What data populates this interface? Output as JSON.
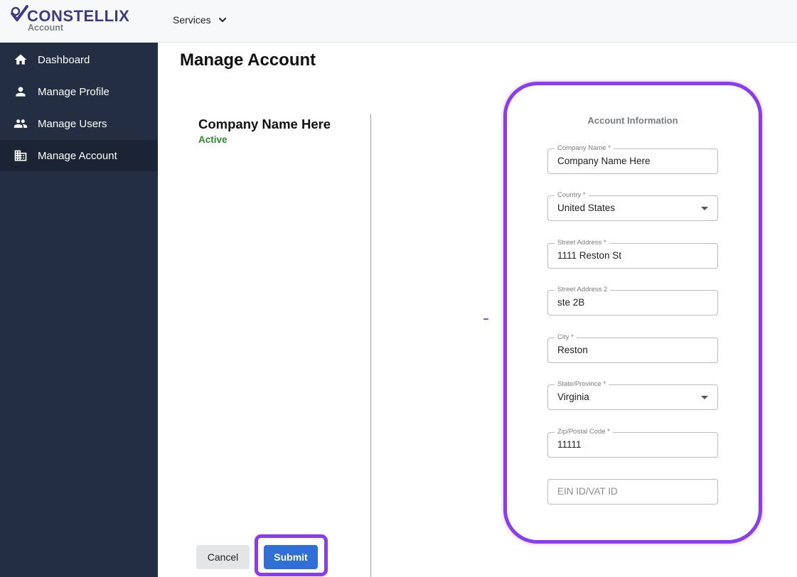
{
  "header": {
    "logo_text": "CONSTELLIX",
    "logo_subtitle": "Account",
    "services_label": "Services"
  },
  "sidebar": {
    "items": [
      {
        "label": "Dashboard",
        "icon": "home-icon",
        "active": false
      },
      {
        "label": "Manage Profile",
        "icon": "person-icon",
        "active": false
      },
      {
        "label": "Manage Users",
        "icon": "people-icon",
        "active": false
      },
      {
        "label": "Manage Account",
        "icon": "building-icon",
        "active": true
      }
    ]
  },
  "main": {
    "page_title": "Manage Account",
    "company": {
      "name": "Company Name Here",
      "status": "Active"
    },
    "account_info": {
      "title": "Account Information",
      "fields": [
        {
          "label": "Company Name *",
          "value": "Company Name Here",
          "type": "text"
        },
        {
          "label": "Country *",
          "value": "United States",
          "type": "select"
        },
        {
          "label": "Street Address *",
          "value": "1111 Reston St",
          "type": "text"
        },
        {
          "label": "Street Address 2",
          "value": "ste 2B",
          "type": "text"
        },
        {
          "label": "City *",
          "value": "Reston",
          "type": "text"
        },
        {
          "label": "State/Province *",
          "value": "Virginia",
          "type": "select"
        },
        {
          "label": "Zip/Postal Code *",
          "value": "11111",
          "type": "text"
        },
        {
          "placeholder": "EIN ID/VAT ID",
          "value": "",
          "type": "text"
        }
      ]
    },
    "actions": {
      "cancel_label": "Cancel",
      "submit_label": "Submit"
    }
  },
  "colors": {
    "sidebar_bg": "#232e42",
    "brand": "#3d3b86",
    "highlight": "#8a3cf0",
    "status_active": "#2e8b2e",
    "primary_button": "#2f6fd6"
  }
}
